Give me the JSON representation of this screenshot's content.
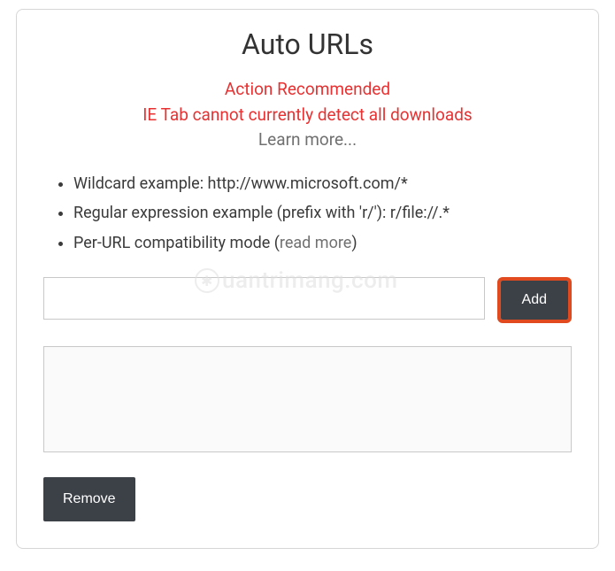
{
  "title": "Auto URLs",
  "warning": {
    "line1": "Action Recommended",
    "line2": "IE Tab cannot currently detect all downloads",
    "learn_more": "Learn more..."
  },
  "examples": {
    "wildcard": "Wildcard example: http://www.microsoft.com/*",
    "regex": "Regular expression example (prefix with 'r/'): r/file://.*",
    "compat_prefix": "Per-URL compatibility mode (",
    "compat_link": "read more",
    "compat_suffix": ")"
  },
  "input": {
    "value": "",
    "placeholder": ""
  },
  "buttons": {
    "add": "Add",
    "remove": "Remove"
  },
  "list": {
    "value": ""
  },
  "watermark": {
    "text": "uantrimang.com"
  }
}
